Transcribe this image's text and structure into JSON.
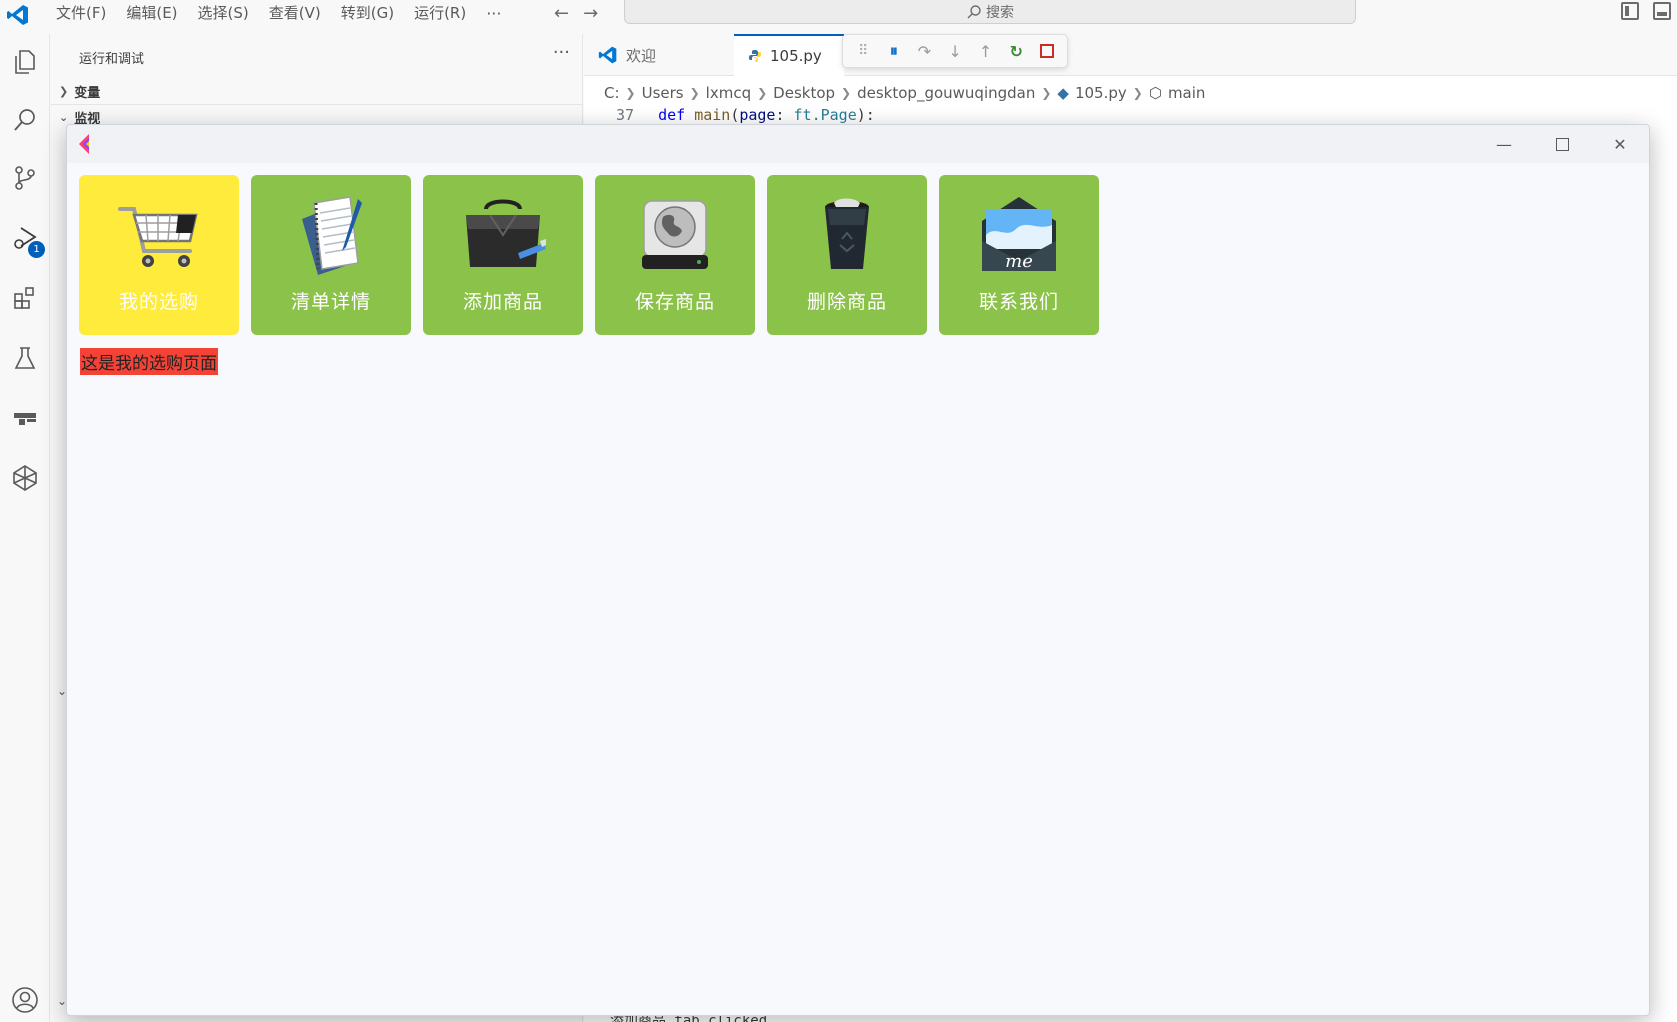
{
  "menu": [
    "文件(F)",
    "编辑(E)",
    "选择(S)",
    "查看(V)",
    "转到(G)",
    "运行(R)"
  ],
  "menu_more": "···",
  "search_placeholder": "搜索",
  "debug_badge": "1",
  "sidebar": {
    "title": "运行和调试",
    "more": "···",
    "sections": [
      "变量",
      "监视"
    ]
  },
  "tabs": [
    {
      "label": "欢迎",
      "active": false
    },
    {
      "label": "105.py",
      "active": true
    }
  ],
  "breadcrumb": [
    "C:",
    "Users",
    "lxmcq",
    "Desktop",
    "desktop_gouwuqingdan",
    "105.py",
    "main"
  ],
  "code": {
    "line_number": "37",
    "def": "def",
    "fn": "main",
    "open": "(",
    "param": "page",
    "colon": ": ",
    "module": "ft",
    "dot_type": ".Page",
    "close": "):"
  },
  "terminal_fragment": "添加商品 tab clicked",
  "app": {
    "tiles": [
      {
        "label": "我的选购",
        "icon": "shopping-cart-icon",
        "selected": true
      },
      {
        "label": "清单详情",
        "icon": "notepad-icon",
        "selected": false
      },
      {
        "label": "添加商品",
        "icon": "bag-icon",
        "selected": false
      },
      {
        "label": "保存商品",
        "icon": "globe-drive-icon",
        "selected": false
      },
      {
        "label": "删除商品",
        "icon": "trash-bin-icon",
        "selected": false
      },
      {
        "label": "联系我们",
        "icon": "envelope-icon",
        "selected": false
      }
    ],
    "message": "这是我的选购页面",
    "colors": {
      "tile_default": "#8bc34a",
      "tile_selected": "#ffeb3b",
      "message_bg": "#f44336"
    }
  }
}
